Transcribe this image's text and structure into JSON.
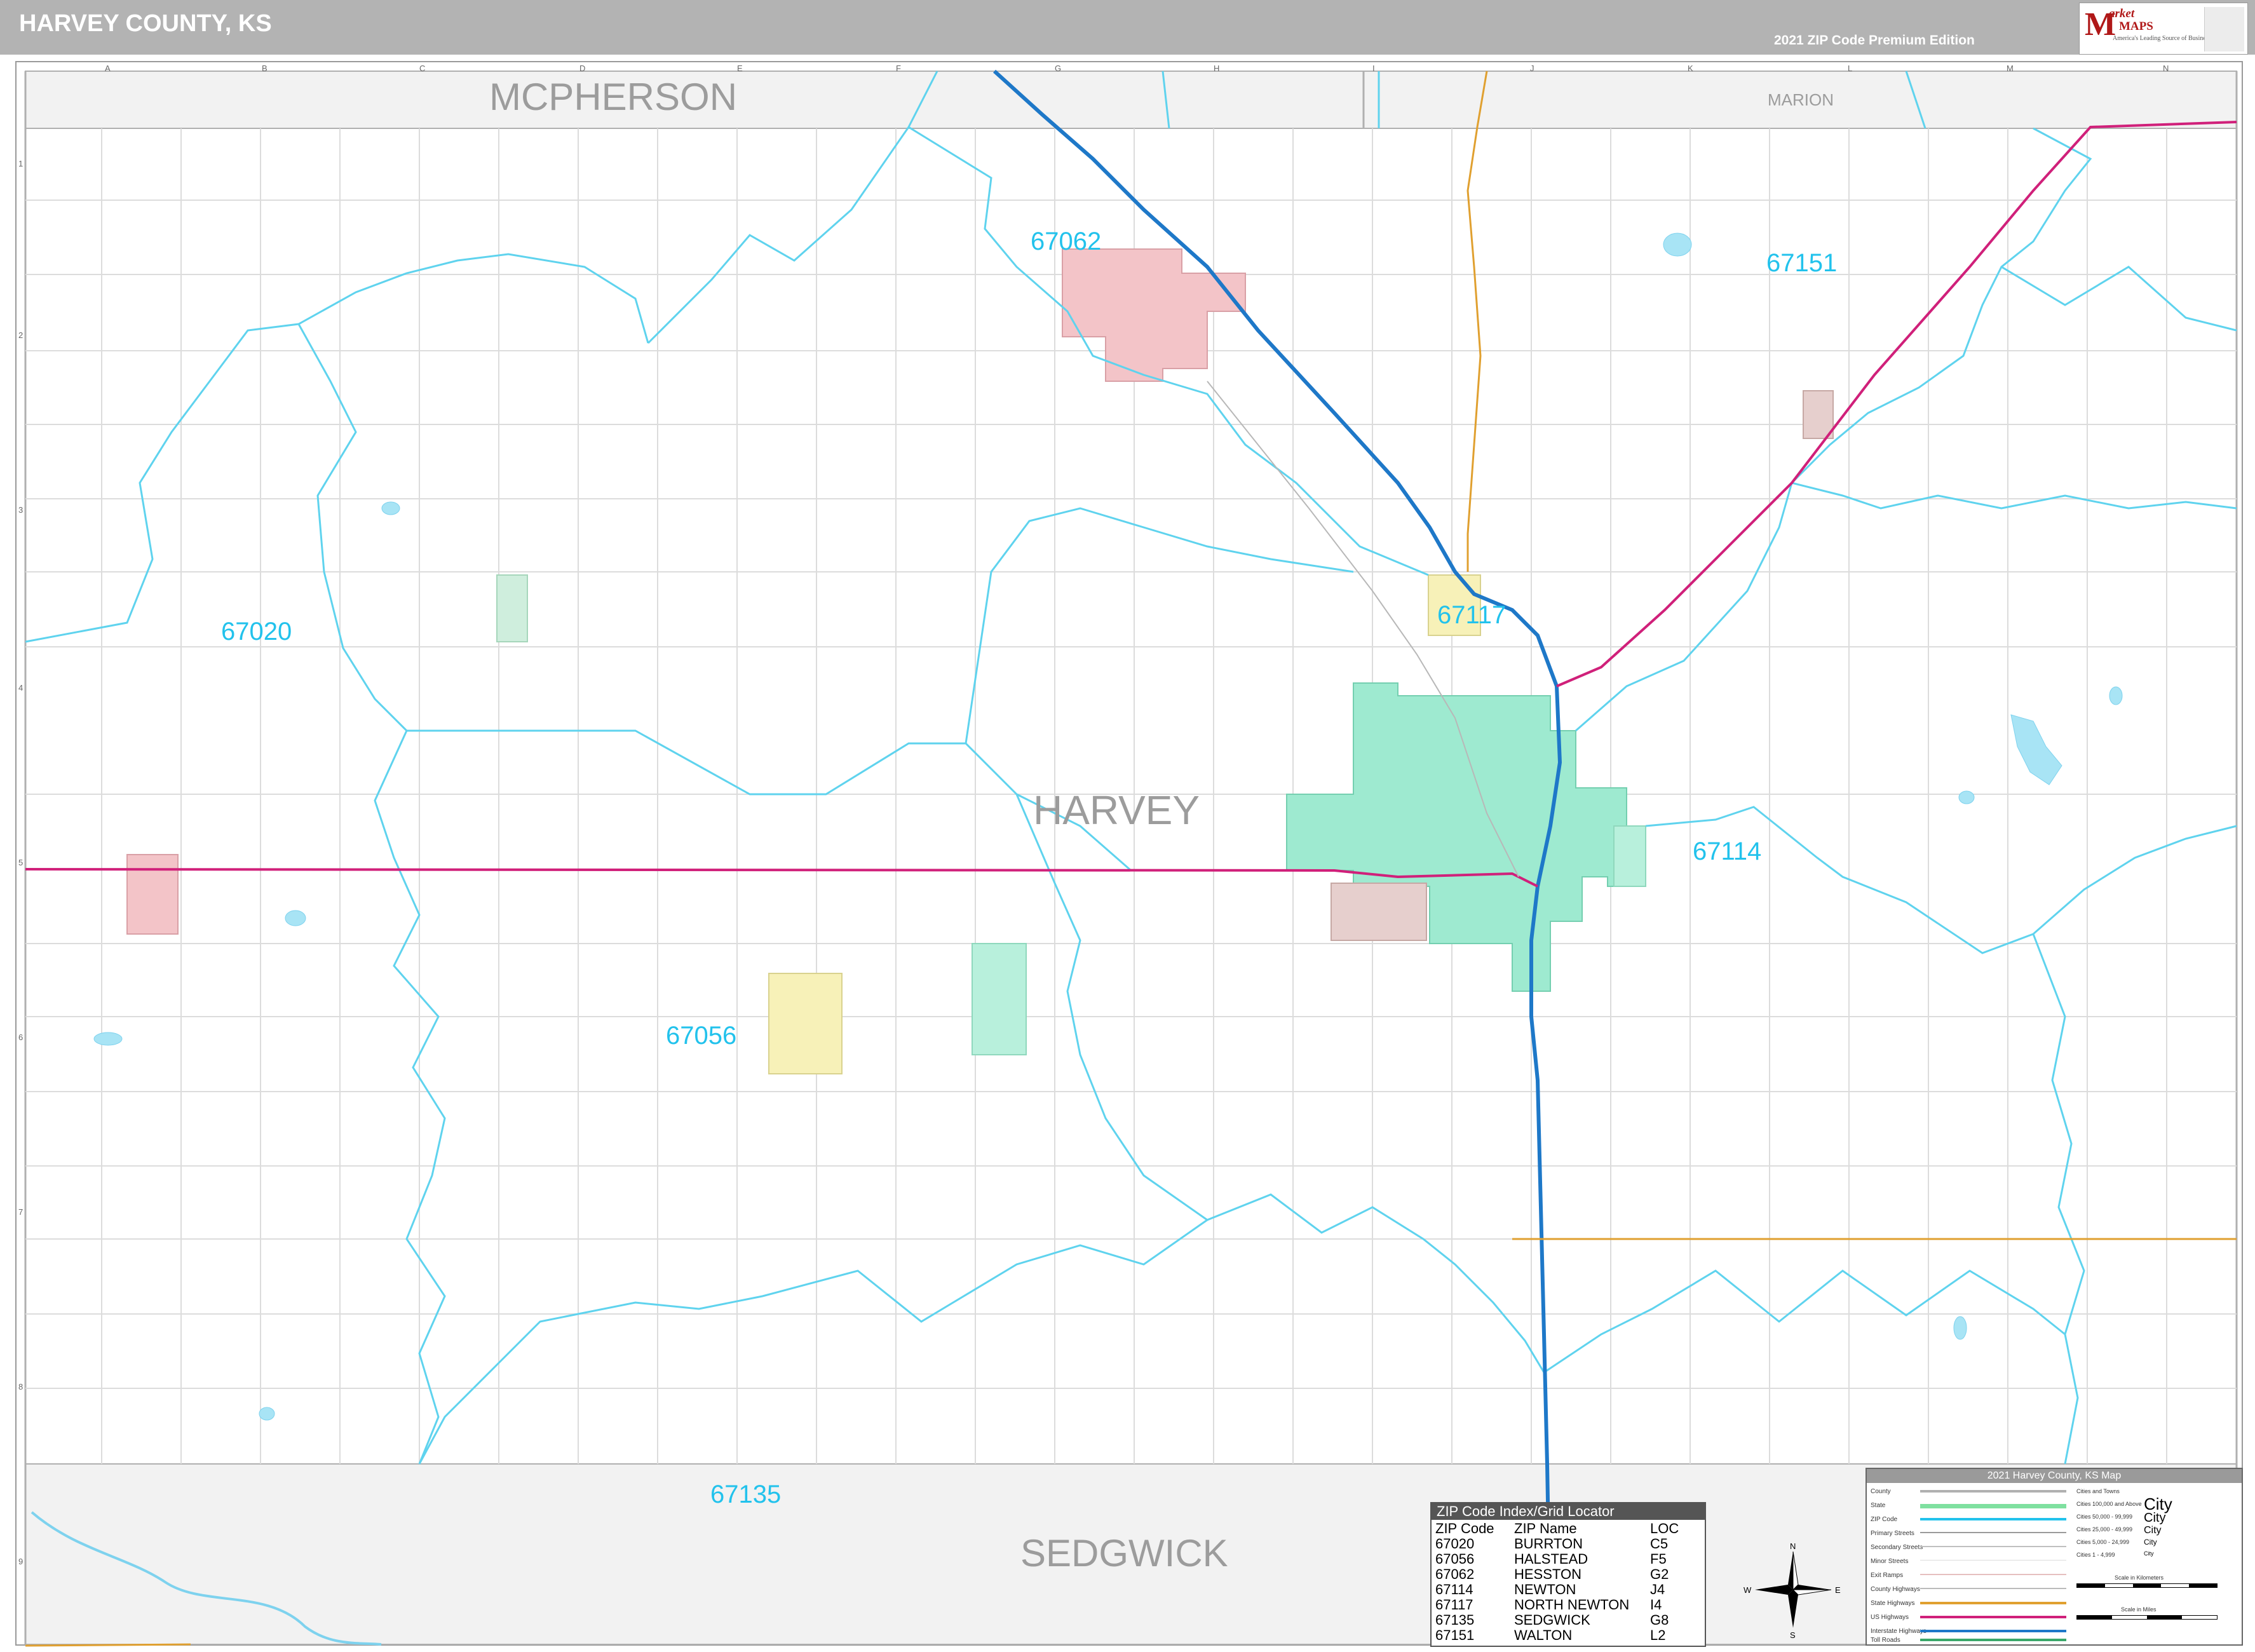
{
  "header": {
    "title": "HARVEY COUNTY, KS",
    "edition": "2021 ZIP Code Premium Edition"
  },
  "logo": {
    "letter": "M",
    "word1": "arket",
    "word2": "MAPS",
    "tagline": "America's Leading Source of Business Maps"
  },
  "counties": {
    "main": "HARVEY",
    "north": "MCPHERSON",
    "south": "SEDGWICK",
    "northeast": "MARION"
  },
  "grid": {
    "columns": [
      "A",
      "B",
      "C",
      "D",
      "E",
      "F",
      "G",
      "H",
      "I",
      "J",
      "K",
      "L",
      "M",
      "N"
    ],
    "rows": [
      "1",
      "2",
      "3",
      "4",
      "5",
      "6",
      "7",
      "8",
      "9"
    ]
  },
  "zips": [
    {
      "code": "67062"
    },
    {
      "code": "67151"
    },
    {
      "code": "67020"
    },
    {
      "code": "67117"
    },
    {
      "code": "67114"
    },
    {
      "code": "67056"
    },
    {
      "code": "67135"
    }
  ],
  "index": {
    "title": "ZIP Code Index/Grid Locator",
    "headers": [
      "ZIP Code",
      "ZIP Name",
      "LOC"
    ],
    "rows": [
      [
        "67020",
        "BURRTON",
        "C5"
      ],
      [
        "67056",
        "HALSTEAD",
        "F5"
      ],
      [
        "67062",
        "HESSTON",
        "G2"
      ],
      [
        "67114",
        "NEWTON",
        "J4"
      ],
      [
        "67117",
        "NORTH NEWTON",
        "I4"
      ],
      [
        "67135",
        "SEDGWICK",
        "G8"
      ],
      [
        "67151",
        "WALTON",
        "L2"
      ]
    ]
  },
  "legend": {
    "title": "2021 Harvey County, KS Map",
    "items": [
      "County",
      "State",
      "ZIP Code",
      "Primary Streets",
      "Secondary Streets",
      "Minor Streets",
      "Exit Ramps",
      "County Highways",
      "State Highways",
      "US Highways",
      "Interstate Highways",
      "Toll Roads"
    ],
    "cities_title": "Cities and Towns",
    "cities": [
      "Cities 100,000 and Above",
      "Cities 50,000 - 99,999",
      "Cities 25,000 - 49,999",
      "Cities 5,000 - 24,999",
      "Cities 1 - 4,999"
    ],
    "city_samples": [
      "City",
      "City",
      "City",
      "City",
      "City"
    ],
    "scale_km": "Scale in Kilometers",
    "scale_mi": "Scale in Miles",
    "colors": {
      "county": "#b0b0b0",
      "state": "#7fe0a0",
      "zip": "#22c2ec",
      "us_highway": "#d0207a",
      "interstate": "#1e78c8",
      "state_highway": "#e0a030"
    }
  },
  "compass": {
    "n": "N",
    "s": "S",
    "e": "E",
    "w": "W"
  },
  "colors": {
    "zip_boundary": "#5fd3ee",
    "zip_label": "#22c2ec",
    "road_grid": "#d9d9d9",
    "interstate": "#1e78c8",
    "us_highway": "#d0207a",
    "state_highway": "#e0a030",
    "urban_newton": "#9eead0",
    "urban_hesston": "#f3c4c8",
    "urban_halstead": "#f7f1b8",
    "adjacent_band": "#f2f2f2"
  }
}
